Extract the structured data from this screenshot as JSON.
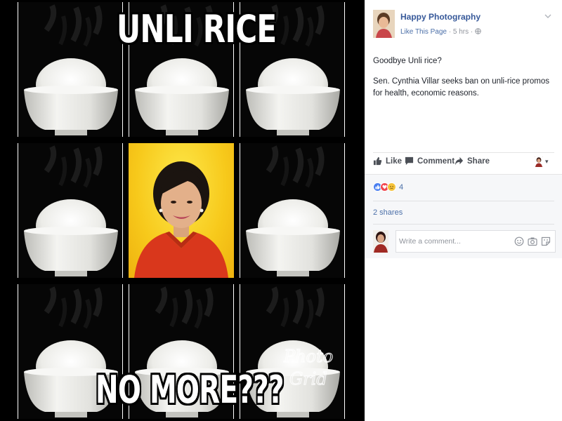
{
  "photo": {
    "top_text": "UNLI RICE",
    "bottom_text": "NO MORE???",
    "watermark_text": "Photo Grid",
    "colors": {
      "background": "#000000",
      "portrait_bg": "#f7c91b",
      "blouse": "#d9371c"
    }
  },
  "post": {
    "page_name": "Happy Photography",
    "like_page": "Like This Page",
    "separator": "·",
    "time": "5 hrs",
    "privacy_icon": "globe-icon",
    "options_icon": "chevron-down-icon",
    "text": [
      "Goodbye Unli rice?",
      "Sen. Cynthia Villar seeks ban on unli-rice promos for health, economic reasons."
    ],
    "actions": {
      "like": "Like",
      "comment": "Comment",
      "share": "Share"
    }
  },
  "feedback": {
    "reactions": [
      "like",
      "love",
      "sad"
    ],
    "reaction_count": "4",
    "shares": "2 shares",
    "comment_placeholder": "Write a comment...",
    "comment_icons": [
      "emoji-icon",
      "camera-icon",
      "sticker-icon"
    ]
  },
  "colors": {
    "link": "#365899",
    "meta_text": "#90949c",
    "action_text": "#4b4f56",
    "feedback_bg": "#f6f7f9"
  }
}
